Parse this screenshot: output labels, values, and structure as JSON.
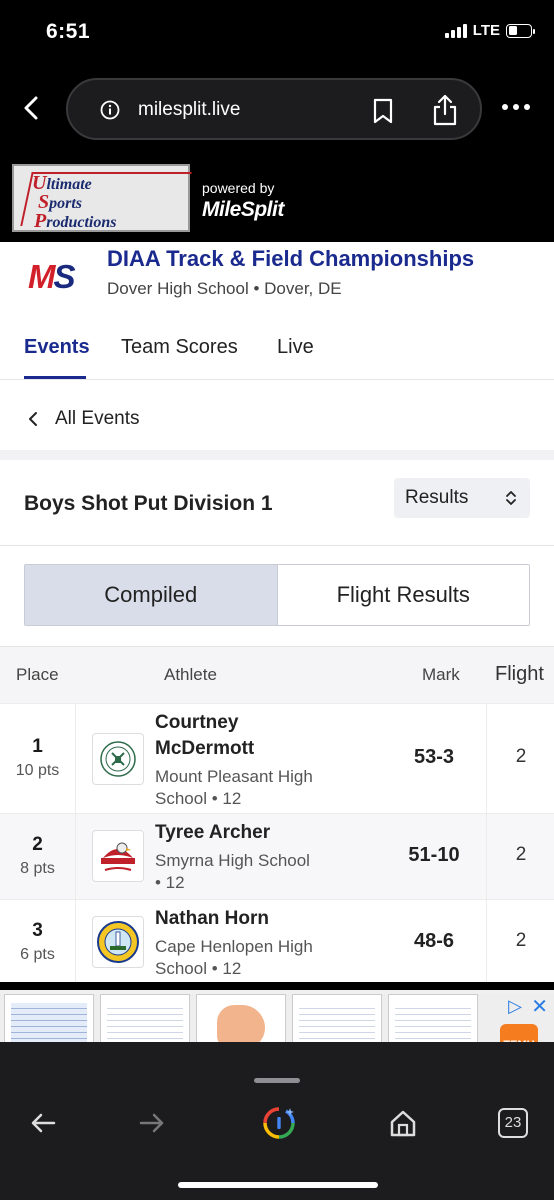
{
  "status_bar": {
    "time": "6:51",
    "network": "LTE",
    "battery_level": 0.4
  },
  "browser": {
    "url": "milesplit.live"
  },
  "sponsor": {
    "logo_lines": [
      {
        "cap": "U",
        "rest": "ltimate"
      },
      {
        "cap": "S",
        "rest": "ports"
      },
      {
        "cap": "P",
        "rest": "roductions"
      }
    ],
    "powered_by": "powered by",
    "brand": "MileSplit"
  },
  "meet": {
    "logo_m": "M",
    "logo_s": "S",
    "title": "DIAA Track & Field Championships",
    "location": "Dover High School • Dover, DE"
  },
  "nav_tabs": [
    {
      "label": "Events",
      "active": true
    },
    {
      "label": "Team Scores",
      "active": false
    },
    {
      "label": "Live",
      "active": false
    }
  ],
  "back_link": "All Events",
  "event": {
    "title": "Boys Shot Put Division 1",
    "view_select": "Results"
  },
  "segments": [
    {
      "label": "Compiled",
      "active": true
    },
    {
      "label": "Flight Results",
      "active": false
    }
  ],
  "results_table": {
    "headers": {
      "place": "Place",
      "athlete": "Athlete",
      "mark": "Mark",
      "flight": "Flight"
    },
    "rows": [
      {
        "place": "1",
        "points": "10 pts",
        "name_lines": [
          "Courtney",
          "McDermott"
        ],
        "school_lines": [
          "Mount Pleasant High",
          "School • 12"
        ],
        "mark": "53-3",
        "flight": "2"
      },
      {
        "place": "2",
        "points": "8 pts",
        "name_lines": [
          "Tyree Archer"
        ],
        "school_lines": [
          "Smyrna High School",
          "• 12"
        ],
        "mark": "51-10",
        "flight": "2"
      },
      {
        "place": "3",
        "points": "6 pts",
        "name_lines": [
          "Nathan Horn"
        ],
        "school_lines": [
          "Cape Henlopen High",
          "School • 12"
        ],
        "mark": "48-6",
        "flight": "2"
      }
    ]
  },
  "ad": {
    "brand": "TEMU"
  },
  "bottom_toolbar": {
    "tab_count": "23"
  },
  "colors": {
    "brand_navy": "#1a2a8e",
    "brand_red": "#d2202a",
    "segment_active": "#d8dde9"
  }
}
